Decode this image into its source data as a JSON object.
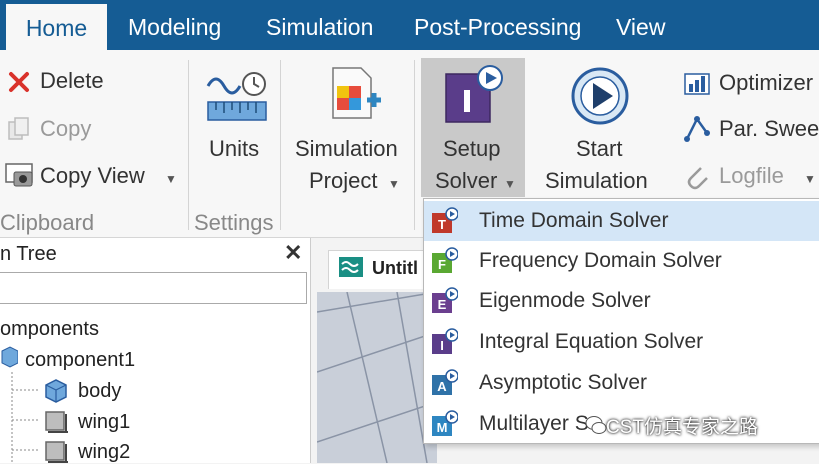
{
  "tabs": [
    "Home",
    "Modeling",
    "Simulation",
    "Post-Processing",
    "View"
  ],
  "clipboard": {
    "delete": "Delete",
    "copy": "Copy",
    "copy_view": "Copy View",
    "group": "Clipboard"
  },
  "settings": {
    "units": "Units",
    "group": "Settings"
  },
  "simulation_project": [
    "Simulation",
    "Project"
  ],
  "setup_solver": [
    "Setup",
    "Solver"
  ],
  "start_simulation": [
    "Start",
    "Simulation"
  ],
  "right_tools": {
    "optimizer": "Optimizer",
    "par_sweep": "Par. Sweep",
    "logfile": "Logfile"
  },
  "tree": {
    "title": "n Tree",
    "items": [
      "omponents",
      "component1",
      "body",
      "wing1",
      "wing2"
    ]
  },
  "doc_tab": "Untitl",
  "solver_menu": [
    {
      "label": "Time Domain Solver",
      "letter": "T",
      "color": "#c0392b"
    },
    {
      "label": "Frequency Domain Solver",
      "letter": "F",
      "color": "#5aa832"
    },
    {
      "label": "Eigenmode Solver",
      "letter": "E",
      "color": "#6b3f8f"
    },
    {
      "label": "Integral Equation Solver",
      "letter": "I",
      "color": "#5a3d8a"
    },
    {
      "label": "Asymptotic Solver",
      "letter": "A",
      "color": "#2f72a8"
    },
    {
      "label": "Multilayer S",
      "letter": "M",
      "color": "#2e86c1"
    }
  ],
  "watermark": "CST仿真专家之路",
  "colors": {
    "tabbar": "#155c94",
    "highlight": "#d4e6f7",
    "active_button": "#c9c9c9"
  }
}
